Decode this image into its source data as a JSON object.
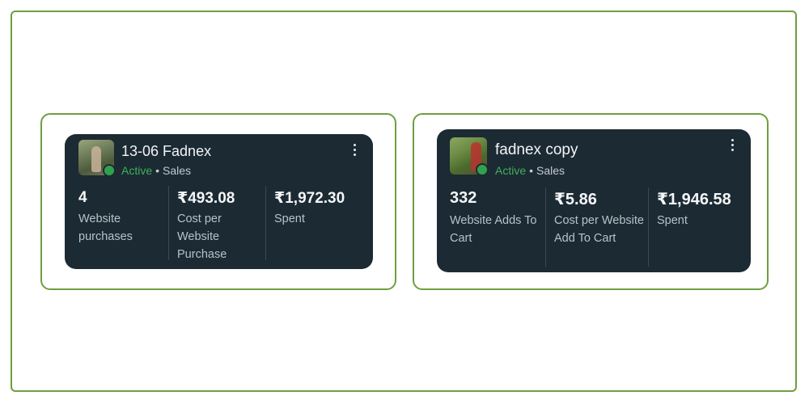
{
  "colors": {
    "frame_border": "#6f9e3f",
    "card_background": "#1c2a33",
    "active_status": "#3fb15a"
  },
  "cards": [
    {
      "ad_name": "13-06 Fadnex",
      "status": "Active",
      "separator": "•",
      "objective": "Sales",
      "more_icon": "more-vertical-icon",
      "metrics": [
        {
          "value": "4",
          "label": "Website purchases"
        },
        {
          "value": "₹493.08",
          "label": "Cost per Website Purchase"
        },
        {
          "value": "₹1,972.30",
          "label": "Spent"
        }
      ]
    },
    {
      "ad_name": "fadnex copy",
      "status": "Active",
      "separator": "•",
      "objective": "Sales",
      "more_icon": "more-vertical-icon",
      "metrics": [
        {
          "value": "332",
          "label": "Website Adds To Cart"
        },
        {
          "value": "₹5.86",
          "label": "Cost per Website Add To Cart"
        },
        {
          "value": "₹1,946.58",
          "label": "Spent"
        }
      ]
    }
  ]
}
